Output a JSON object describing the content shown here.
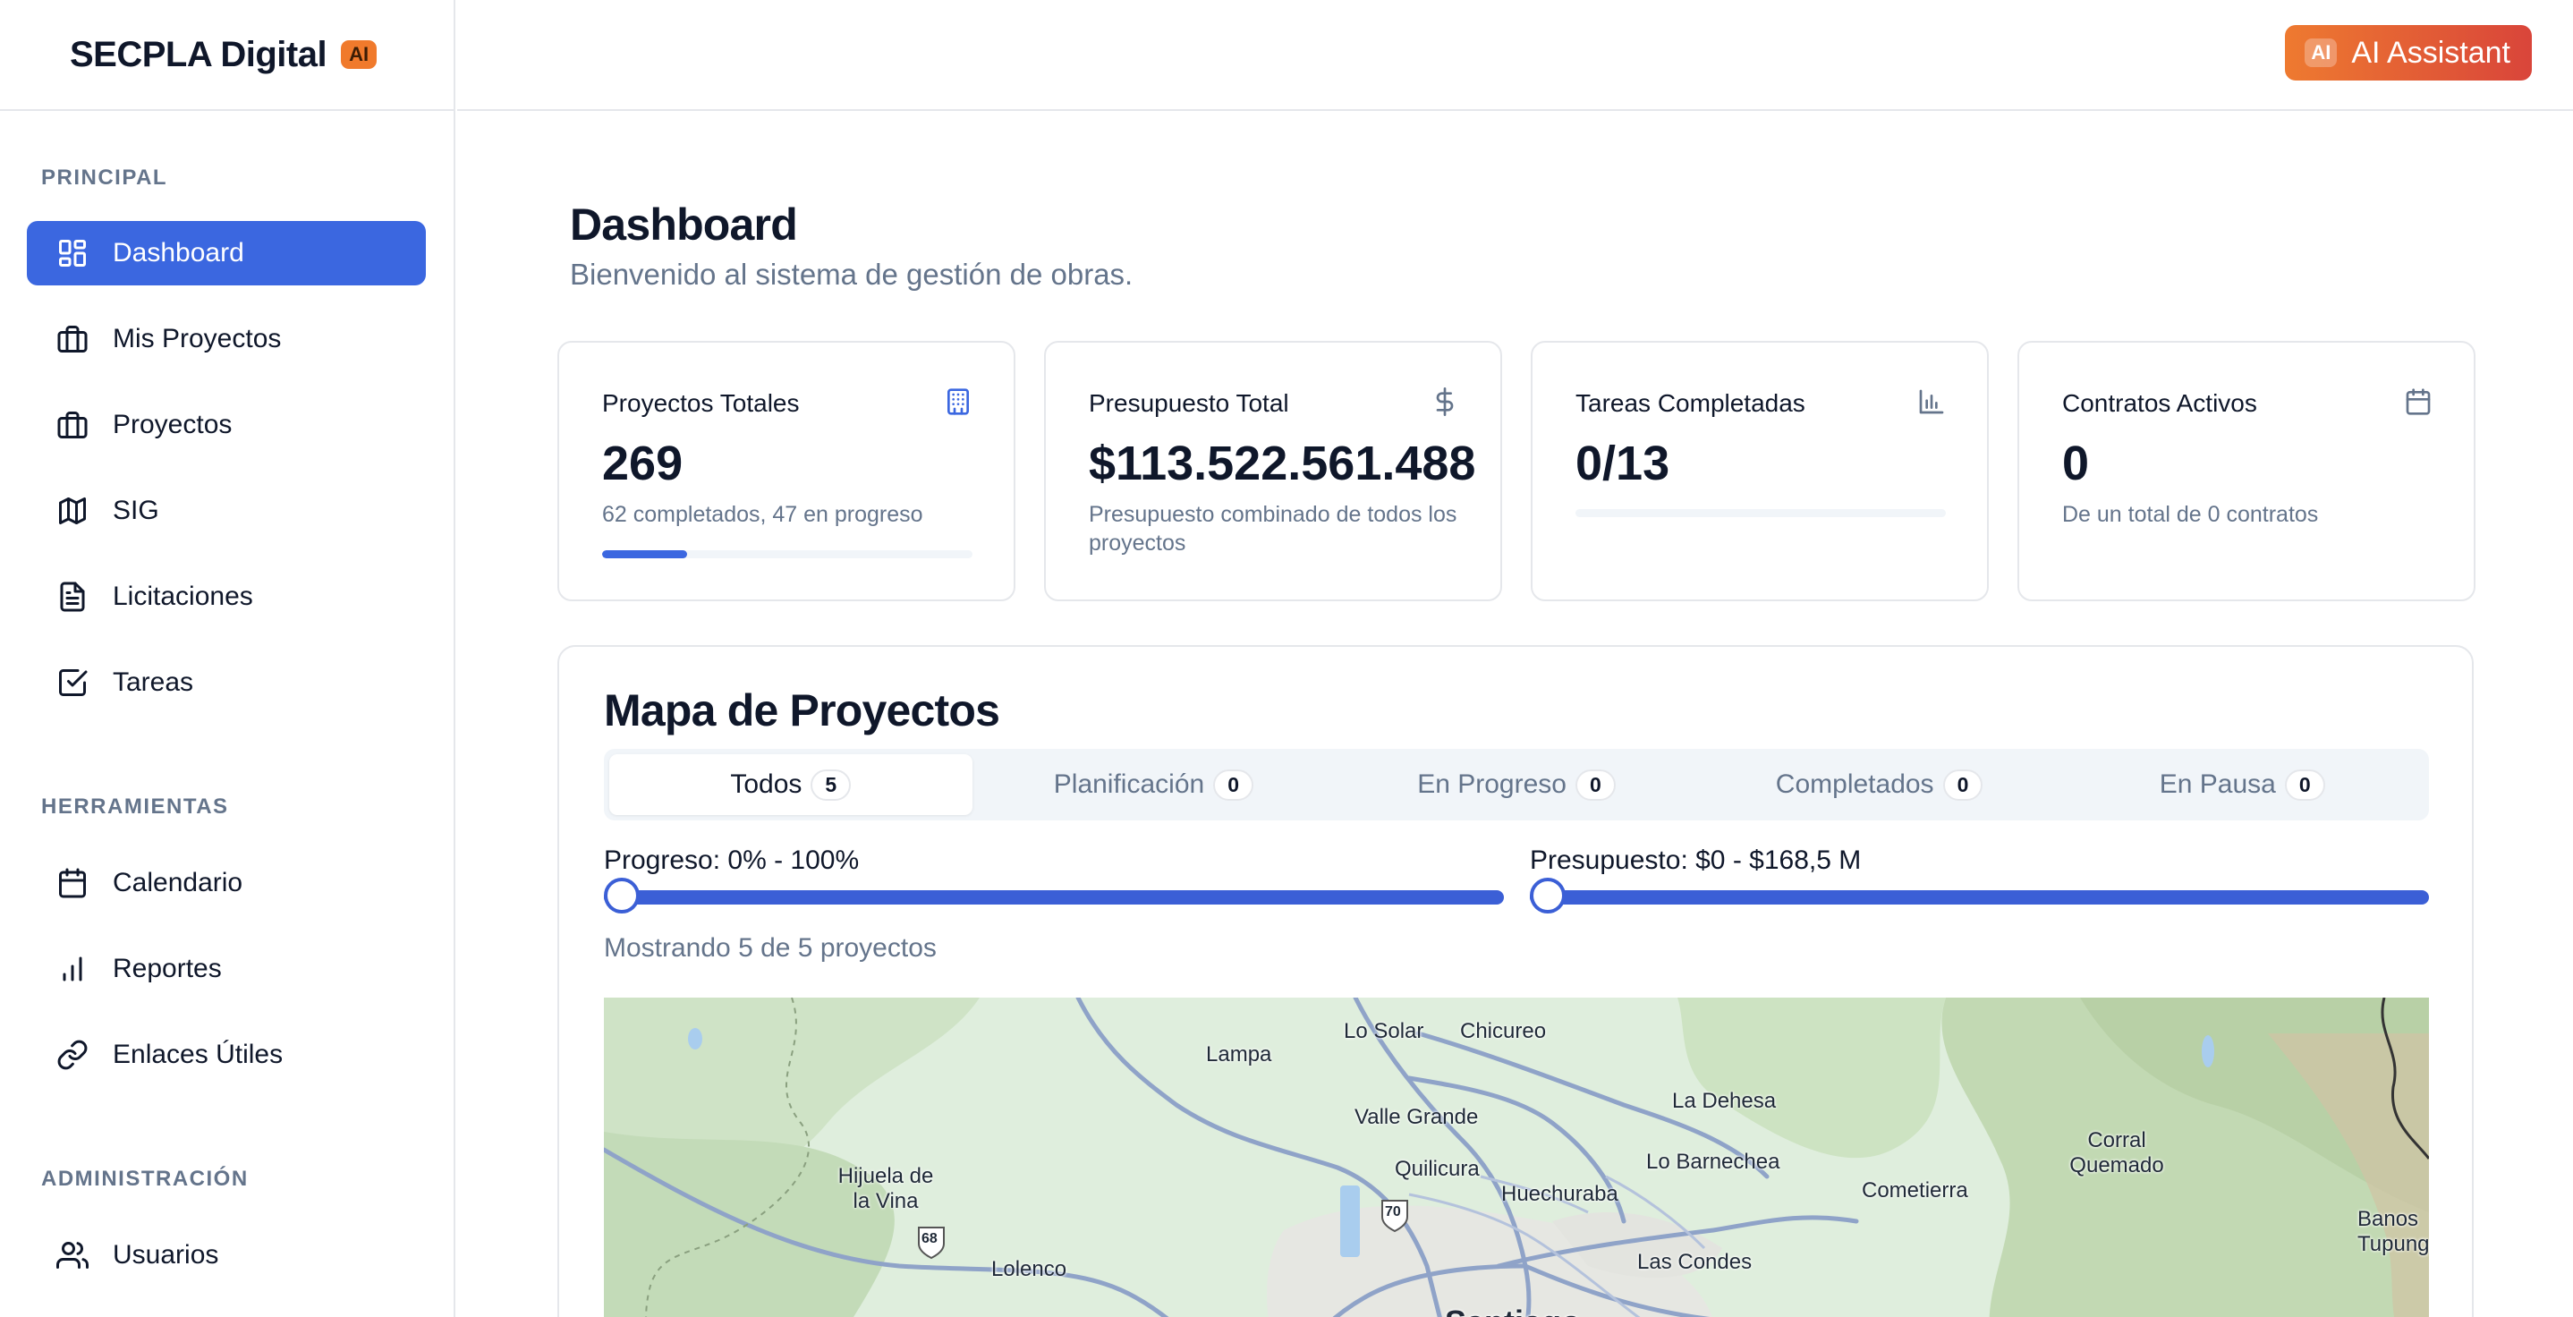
{
  "brand": {
    "name": "SECPLA Digital",
    "badge": "AI"
  },
  "topbar": {
    "assistant_chip": "AI",
    "assistant_label": "AI Assistant"
  },
  "sidebar": {
    "sections": [
      {
        "title": "PRINCIPAL",
        "items": [
          {
            "label": "Dashboard",
            "icon": "dashboard-icon",
            "active": true
          },
          {
            "label": "Mis Proyectos",
            "icon": "briefcase-icon"
          },
          {
            "label": "Proyectos",
            "icon": "briefcase-icon"
          },
          {
            "label": "SIG",
            "icon": "map-icon"
          },
          {
            "label": "Licitaciones",
            "icon": "file-text-icon"
          },
          {
            "label": "Tareas",
            "icon": "check-square-icon"
          }
        ]
      },
      {
        "title": "HERRAMIENTAS",
        "items": [
          {
            "label": "Calendario",
            "icon": "calendar-icon"
          },
          {
            "label": "Reportes",
            "icon": "bar-chart-icon"
          },
          {
            "label": "Enlaces Útiles",
            "icon": "link-icon"
          }
        ]
      },
      {
        "title": "ADMINISTRACIÓN",
        "items": [
          {
            "label": "Usuarios",
            "icon": "users-icon"
          }
        ]
      }
    ]
  },
  "page": {
    "title": "Dashboard",
    "subtitle": "Bienvenido al sistema de gestión de obras."
  },
  "cards": [
    {
      "label": "Proyectos Totales",
      "value": "269",
      "sub": "62 completados, 47 en progreso",
      "icon": "building-icon",
      "progress": 0.23
    },
    {
      "label": "Presupuesto Total",
      "value": "$113.522.561.488",
      "sub": "Presupuesto combinado de todos los proyectos",
      "icon": "dollar-icon"
    },
    {
      "label": "Tareas Completadas",
      "value": "0/13",
      "sub": "",
      "icon": "bar-chart-icon",
      "progress": 0
    },
    {
      "label": "Contratos Activos",
      "value": "0",
      "sub": "De un total de 0 contratos",
      "icon": "calendar-icon"
    }
  ],
  "map_panel": {
    "title": "Mapa de Proyectos",
    "tabs": [
      {
        "label": "Todos",
        "count": "5",
        "active": true
      },
      {
        "label": "Planificación",
        "count": "0"
      },
      {
        "label": "En Progreso",
        "count": "0"
      },
      {
        "label": "Completados",
        "count": "0"
      },
      {
        "label": "En Pausa",
        "count": "0"
      }
    ],
    "progress_filter": {
      "label": "Progreso: 0% - 100%",
      "value_min": 0,
      "value_max": 100
    },
    "budget_filter": {
      "label": "Presupuesto: $0 - $168,5 M",
      "value_min": 0,
      "value_max": 168.5
    },
    "showing": "Mostrando 5 de 5 proyectos",
    "map_labels": [
      "Lo Solar",
      "Chicureo",
      "Lampa",
      "La Dehesa",
      "Valle Grande",
      "Corral Quemado",
      "Lo Barnechea",
      "Hijuela de la Vina",
      "Quilicura",
      "Huechuraba",
      "Cometierra",
      "Banos Tupung",
      "Lolenco",
      "Las Condes",
      "Santiago",
      "68",
      "70"
    ]
  },
  "colors": {
    "primary": "#3b67e0",
    "accent": "#ee7a30",
    "muted": "#64748b"
  }
}
